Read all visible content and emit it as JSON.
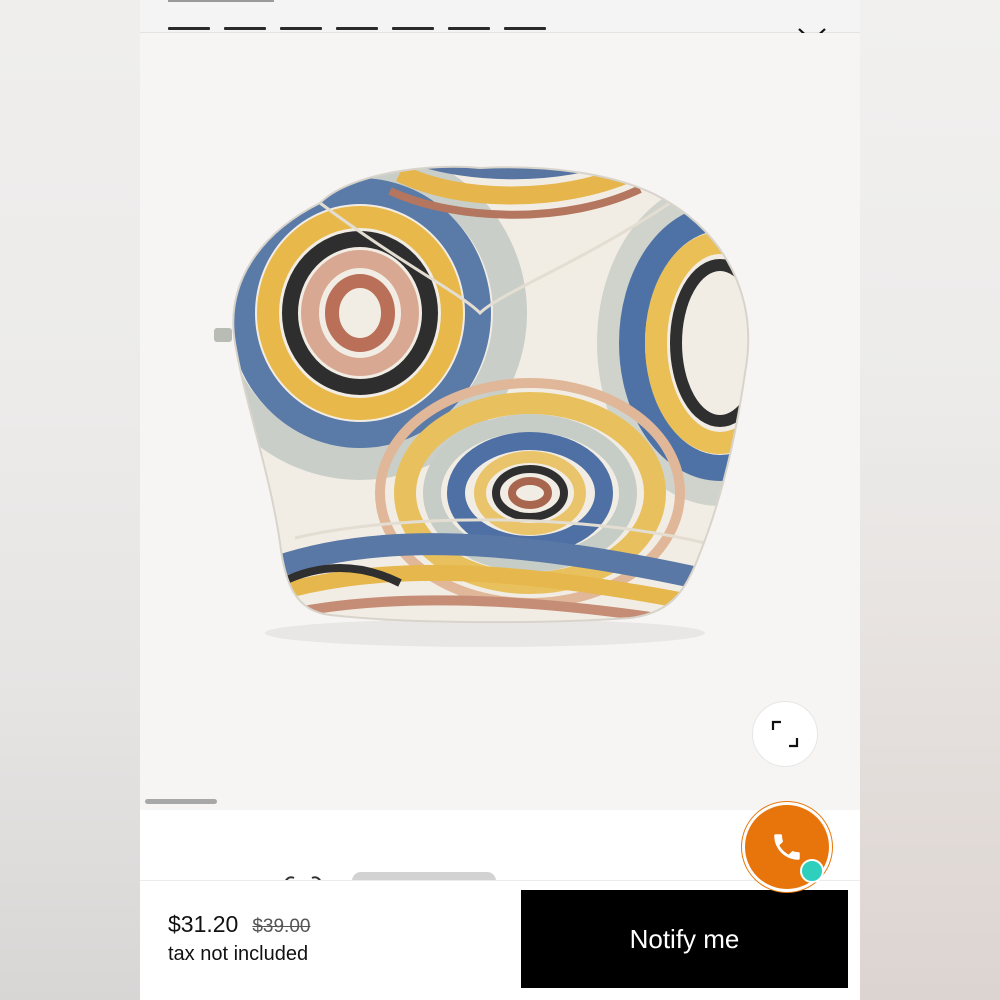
{
  "icons": {
    "top_chevron": "chevron-down-icon",
    "expand": "expand-icon",
    "call": "phone-icon"
  },
  "colors": {
    "call_button": "#e8750b",
    "status_dot": "#2ed0bd",
    "notify_button": "#000000"
  },
  "product": {
    "price_current": "$31.20",
    "price_original": "$39.00",
    "tax_note": "tax not included"
  },
  "actions": {
    "notify_label": "Notify me"
  }
}
